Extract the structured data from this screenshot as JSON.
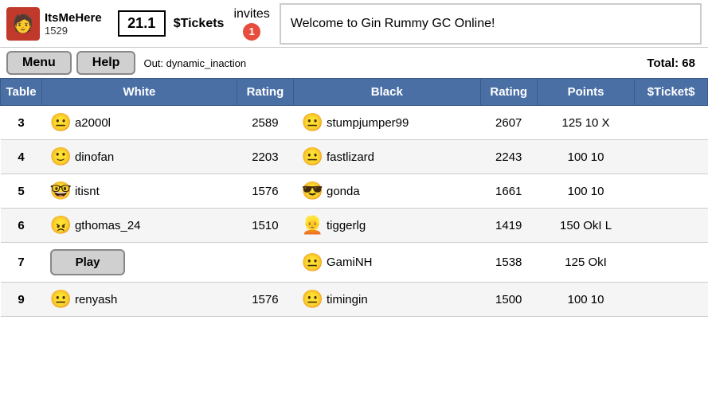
{
  "header": {
    "username": "ItsMeHere",
    "user_id": "1529",
    "tickets_value": "21.1",
    "tickets_label": "$Tickets",
    "invites_label": "invites",
    "invites_count": "1",
    "total_label": "Total: 68",
    "out_text": "Out: dynamic_inaction",
    "welcome_text": "Welcome to Gin Rummy GC Online!",
    "menu_label": "Menu",
    "help_label": "Help",
    "avatar_emoji": "👤"
  },
  "table": {
    "columns": {
      "table": "Table",
      "white": "White",
      "rating_white": "Rating",
      "black": "Black",
      "rating_black": "Rating",
      "points": "Points",
      "tickets": "$Ticket$"
    },
    "rows": [
      {
        "table_num": "3",
        "white_avatar": "😐",
        "white_name": "a2000l",
        "white_rating": "2589",
        "black_avatar": "😐",
        "black_name": "stumpjumper99",
        "black_rating": "2607",
        "points": "125 10 X",
        "tickets": "",
        "has_play": false
      },
      {
        "table_num": "4",
        "white_avatar": "🙂",
        "white_name": "dinofan",
        "white_rating": "2203",
        "black_avatar": "😐",
        "black_name": "fastlizard",
        "black_rating": "2243",
        "points": "100 10",
        "tickets": "",
        "has_play": false
      },
      {
        "table_num": "5",
        "white_avatar": "🤓",
        "white_name": "itisnt",
        "white_rating": "1576",
        "black_avatar": "😎",
        "black_name": "gonda",
        "black_rating": "1661",
        "points": "100 10",
        "tickets": "",
        "has_play": false
      },
      {
        "table_num": "6",
        "white_avatar": "😠",
        "white_name": "gthomas_24",
        "white_rating": "1510",
        "black_avatar": "👱",
        "black_name": "tiggerlg",
        "black_rating": "1419",
        "points": "150 OkI L",
        "tickets": "",
        "has_play": false
      },
      {
        "table_num": "7",
        "white_avatar": "",
        "white_name": "",
        "white_rating": "",
        "black_avatar": "😐",
        "black_name": "GamiNH",
        "black_rating": "1538",
        "points": "125 OkI",
        "tickets": "",
        "has_play": true
      },
      {
        "table_num": "9",
        "white_avatar": "😐",
        "white_name": "renyash",
        "white_rating": "1576",
        "black_avatar": "😐",
        "black_name": "timingin",
        "black_rating": "1500",
        "points": "100 10",
        "tickets": "",
        "has_play": false
      }
    ],
    "play_label": "Play"
  }
}
